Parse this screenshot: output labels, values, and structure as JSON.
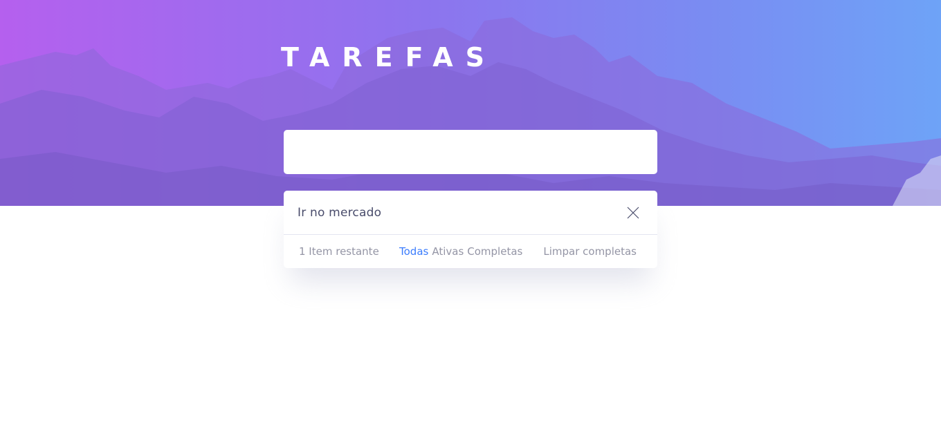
{
  "header": {
    "title": "TAREFAS"
  },
  "new_todo": {
    "value": "",
    "placeholder": ""
  },
  "todos": [
    {
      "text": "Ir no mercado",
      "completed": false
    }
  ],
  "footer": {
    "items_left": "1 Item restante",
    "filters": [
      {
        "label": "Todas",
        "active": true
      },
      {
        "label": "Ativas",
        "active": false
      },
      {
        "label": "Completas",
        "active": false
      }
    ],
    "clear_label": "Limpar completas"
  },
  "colors": {
    "active_filter": "#3a7cfd",
    "muted_text": "#9495a5",
    "todo_text": "#494c6b",
    "hero_gradient_start": "#b560ee",
    "hero_gradient_end": "#6ea3f7"
  },
  "icons": {
    "delete": "close-icon",
    "background": "mountain-landscape"
  }
}
